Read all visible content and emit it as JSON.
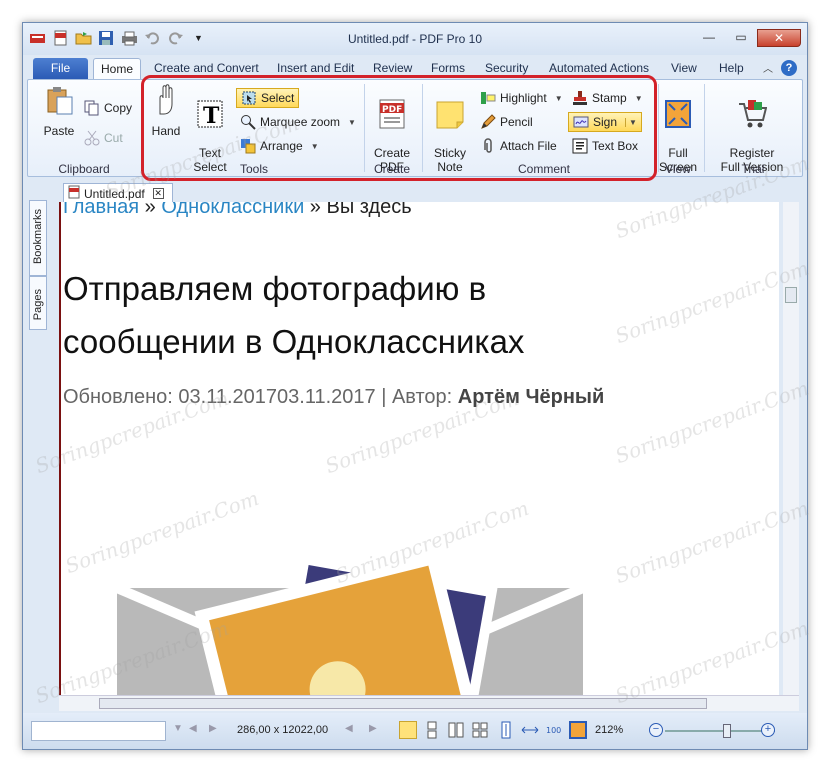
{
  "window": {
    "title": "Untitled.pdf - PDF Pro 10"
  },
  "tabs": {
    "file": "File",
    "home": "Home",
    "others": [
      "Create and Convert",
      "Insert and Edit",
      "Review",
      "Forms",
      "Security",
      "Automated Actions",
      "View",
      "Help"
    ]
  },
  "ribbon": {
    "clipboard": {
      "paste": "Paste",
      "copy": "Copy",
      "cut": "Cut",
      "label": "Clipboard"
    },
    "tools": {
      "hand": "Hand",
      "text_select": "Text\nSelect",
      "select": "Select",
      "marquee_zoom": "Marquee zoom",
      "arrange": "Arrange",
      "label": "Tools"
    },
    "create": {
      "create_pdf": "Create\nPDF",
      "label": "Create"
    },
    "comment": {
      "sticky_note": "Sticky\nNote",
      "highlight": "Highlight",
      "pencil": "Pencil",
      "attach_file": "Attach File",
      "stamp": "Stamp",
      "sign": "Sign",
      "text_box": "Text Box",
      "label": "Comment"
    },
    "view": {
      "full_screen": "Full\nScreen",
      "label": "View"
    },
    "trial": {
      "register": "Register\nFull Version",
      "label": "Trial"
    }
  },
  "sidebar": {
    "bookmarks": "Bookmarks",
    "pages": "Pages"
  },
  "document": {
    "tab": "Untitled.pdf",
    "breadcrumb_home": "Главная",
    "breadcrumb_sep1": " » ",
    "breadcrumb_section": "Одноклассники",
    "breadcrumb_sep2": " » ",
    "breadcrumb_current": "Вы здесь",
    "heading": "Отправляем фотографию в сообщении в Одноклассниках",
    "updated_label": "Обновлено: 03.11.201703.11.2017 | Автор: ",
    "author": "Артём Чёрный"
  },
  "statusbar": {
    "dimensions": "286,00 x 12022,00",
    "zoom": "212%"
  },
  "watermark": "Soringpcrepair.Com",
  "colors": {
    "file_tab": "#2b5bb5",
    "highlight_box": "#d3222a",
    "link": "#2a86c4"
  }
}
